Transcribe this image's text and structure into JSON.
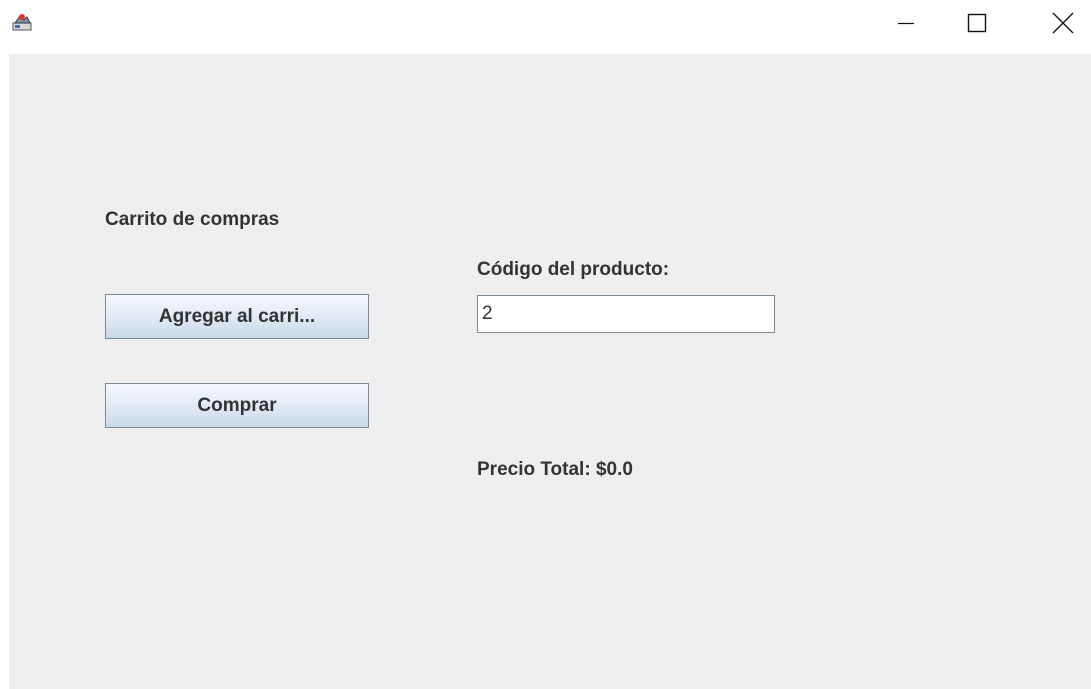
{
  "window": {
    "icon": "java-cup-icon",
    "controls": {
      "minimize": "minimize-icon",
      "maximize": "maximize-icon",
      "close": "close-icon"
    }
  },
  "cart": {
    "title": "Carrito de compras",
    "add_button_label": "Agregar al carri...",
    "buy_button_label": "Comprar",
    "product_code_label": "Código del producto:",
    "product_code_value": "2",
    "total_label": "Precio Total: $0.0"
  },
  "colors": {
    "panel_background": "#eeeeee",
    "text": "#333333",
    "button_border": "#7a8a99"
  }
}
